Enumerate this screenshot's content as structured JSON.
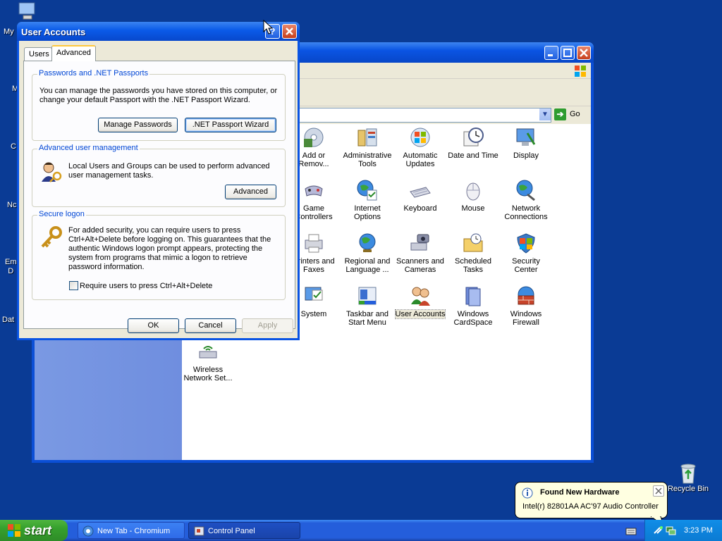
{
  "desktop": {
    "icons": [
      {
        "label": "My",
        "icon": "my-computer-icon"
      },
      {
        "label": "M"
      },
      {
        "label": "C"
      },
      {
        "label": "Nc"
      },
      {
        "label": "Em\nD"
      },
      {
        "label": "Dat"
      },
      {
        "label": "Recycle Bin",
        "icon": "recycle-bin-icon"
      }
    ]
  },
  "control_panel": {
    "address": {
      "go_label": "Go"
    },
    "items": [
      {
        "label": "Add or\nRemov...",
        "icon": "add-remove-programs-icon"
      },
      {
        "label": "Administrative\nTools",
        "icon": "administrative-tools-icon"
      },
      {
        "label": "Automatic\nUpdates",
        "icon": "automatic-updates-icon"
      },
      {
        "label": "Date and Time",
        "icon": "date-time-icon"
      },
      {
        "label": "Display",
        "icon": "display-icon"
      },
      {
        "label": "Game\nControllers",
        "icon": "game-controllers-icon"
      },
      {
        "label": "Internet\nOptions",
        "icon": "internet-options-icon"
      },
      {
        "label": "Keyboard",
        "icon": "keyboard-icon"
      },
      {
        "label": "Mouse",
        "icon": "mouse-icon"
      },
      {
        "label": "Network\nConnections",
        "icon": "network-connections-icon"
      },
      {
        "label": "Printers and\nFaxes",
        "icon": "printers-faxes-icon"
      },
      {
        "label": "Regional and\nLanguage ...",
        "icon": "regional-language-icon"
      },
      {
        "label": "Scanners and\nCameras",
        "icon": "scanners-cameras-icon"
      },
      {
        "label": "Scheduled\nTasks",
        "icon": "scheduled-tasks-icon"
      },
      {
        "label": "Security\nCenter",
        "icon": "security-center-icon"
      },
      {
        "label": "System",
        "icon": "system-icon"
      },
      {
        "label": "Taskbar and\nStart Menu",
        "icon": "taskbar-start-menu-icon"
      },
      {
        "label": "User Accounts",
        "icon": "user-accounts-icon",
        "selected": true
      },
      {
        "label": "Windows\nCardSpace",
        "icon": "windows-cardspace-icon"
      },
      {
        "label": "Windows\nFirewall",
        "icon": "windows-firewall-icon"
      },
      {
        "label": "Wireless\nNetwork Set...",
        "icon": "wireless-network-icon"
      }
    ]
  },
  "dialog": {
    "title": "User Accounts",
    "tabs": [
      {
        "label": "Users"
      },
      {
        "label": "Advanced",
        "active": true
      }
    ],
    "passwords_group": {
      "legend": "Passwords and .NET Passports",
      "text": "You can manage the passwords you have stored on this computer, or change your default Passport with the .NET Passport Wizard.",
      "manage_button": "Manage Passwords",
      "wizard_button": ".NET Passport Wizard"
    },
    "advanced_group": {
      "legend": "Advanced user management",
      "text": "Local Users and Groups can be used to perform advanced user management tasks.",
      "advanced_button": "Advanced"
    },
    "secure_group": {
      "legend": "Secure logon",
      "text": "For added security, you can require users to press Ctrl+Alt+Delete before logging on. This guarantees that the authentic Windows logon prompt appears, protecting the system from programs that mimic a logon to retrieve password information.",
      "checkbox_label": "Require users to press Ctrl+Alt+Delete",
      "checked": false
    },
    "buttons": {
      "ok": "OK",
      "cancel": "Cancel",
      "apply": "Apply"
    }
  },
  "balloon": {
    "title": "Found New Hardware",
    "text": "Intel(r) 82801AA AC'97 Audio Controller"
  },
  "taskbar": {
    "start_label": "start",
    "tasks": [
      {
        "label": "New Tab - Chromium",
        "icon": "chromium-icon"
      },
      {
        "label": "Control Panel",
        "icon": "control-panel-icon",
        "active": true
      }
    ],
    "clock": "3:23 PM"
  },
  "colors": {
    "desktop": "#0a3b95",
    "title_bar": "#0a54e3",
    "group_legend": "#0046d5",
    "start_button": "#36a02d"
  }
}
